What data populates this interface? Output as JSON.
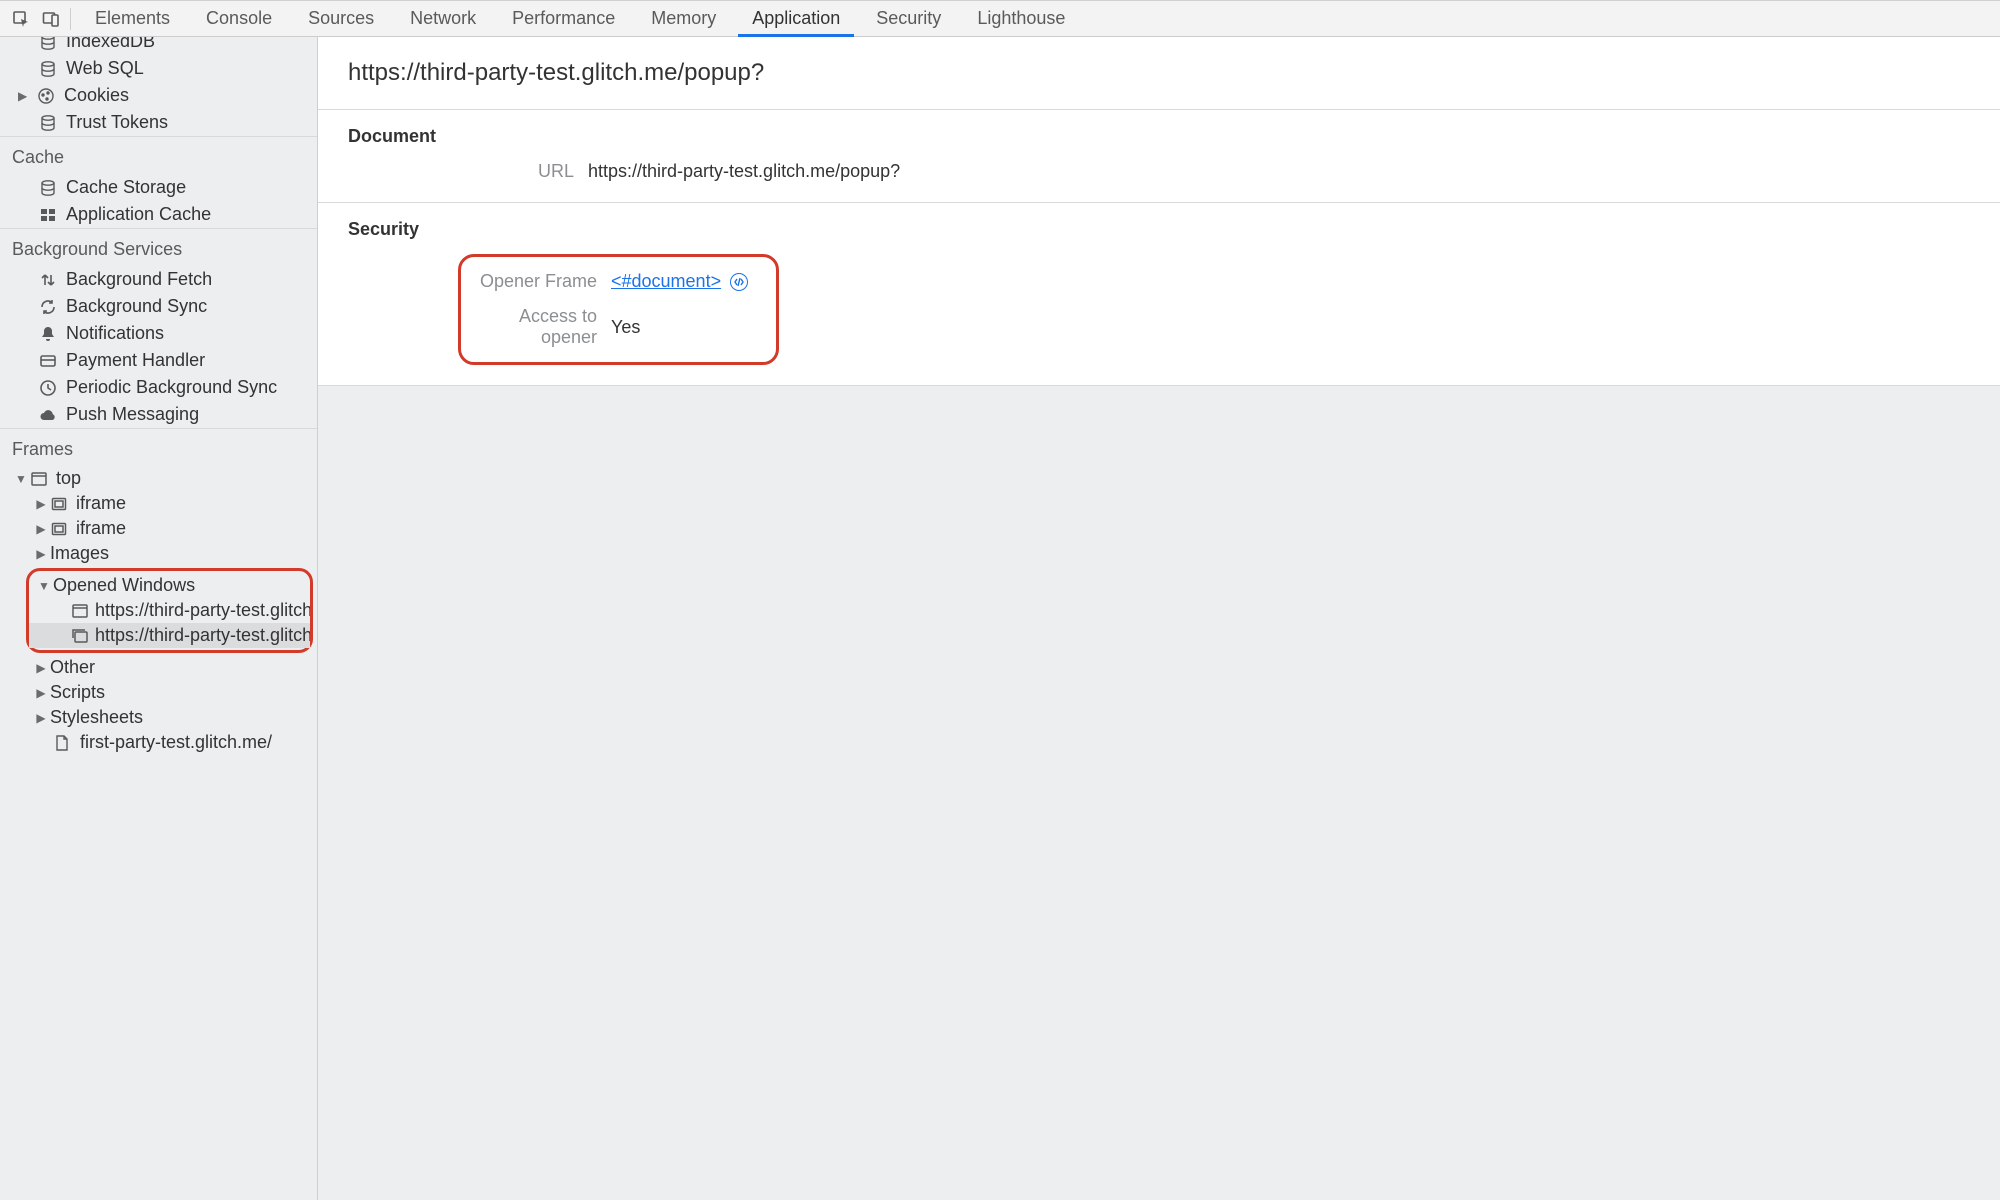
{
  "tabbar": {
    "tabs": [
      {
        "label": "Elements"
      },
      {
        "label": "Console"
      },
      {
        "label": "Sources"
      },
      {
        "label": "Network"
      },
      {
        "label": "Performance"
      },
      {
        "label": "Memory"
      },
      {
        "label": "Application"
      },
      {
        "label": "Security"
      },
      {
        "label": "Lighthouse"
      }
    ],
    "active_index": 6
  },
  "sidebar": {
    "storage": {
      "items": [
        {
          "label": "IndexedDB",
          "icon": "db"
        },
        {
          "label": "Web SQL",
          "icon": "db"
        },
        {
          "label": "Cookies",
          "icon": "cookie",
          "expandable": true
        },
        {
          "label": "Trust Tokens",
          "icon": "db"
        }
      ]
    },
    "cache": {
      "title": "Cache",
      "items": [
        {
          "label": "Cache Storage",
          "icon": "db"
        },
        {
          "label": "Application Cache",
          "icon": "grid"
        }
      ]
    },
    "bgservices": {
      "title": "Background Services",
      "items": [
        {
          "label": "Background Fetch",
          "icon": "updown"
        },
        {
          "label": "Background Sync",
          "icon": "sync"
        },
        {
          "label": "Notifications",
          "icon": "bell"
        },
        {
          "label": "Payment Handler",
          "icon": "card"
        },
        {
          "label": "Periodic Background Sync",
          "icon": "clock"
        },
        {
          "label": "Push Messaging",
          "icon": "cloud"
        }
      ]
    },
    "frames": {
      "title": "Frames",
      "top": {
        "label": "top"
      },
      "iframe1": {
        "label": "iframe"
      },
      "iframe2": {
        "label": "iframe"
      },
      "images": {
        "label": "Images"
      },
      "opened": {
        "label": "Opened Windows",
        "items": [
          {
            "label": "https://third-party-test.glitch.m"
          },
          {
            "label": "https://third-party-test.glitch.m"
          }
        ]
      },
      "other": {
        "label": "Other"
      },
      "scripts": {
        "label": "Scripts"
      },
      "stylesheets": {
        "label": "Stylesheets"
      },
      "leaf": {
        "label": "first-party-test.glitch.me/"
      }
    }
  },
  "detail": {
    "url": "https://third-party-test.glitch.me/popup?",
    "document": {
      "title": "Document",
      "url_label": "URL",
      "url_value": "https://third-party-test.glitch.me/popup?"
    },
    "security": {
      "title": "Security",
      "opener_label": "Opener Frame",
      "opener_value": "<#document>",
      "access_label": "Access to opener",
      "access_value": "Yes"
    }
  }
}
